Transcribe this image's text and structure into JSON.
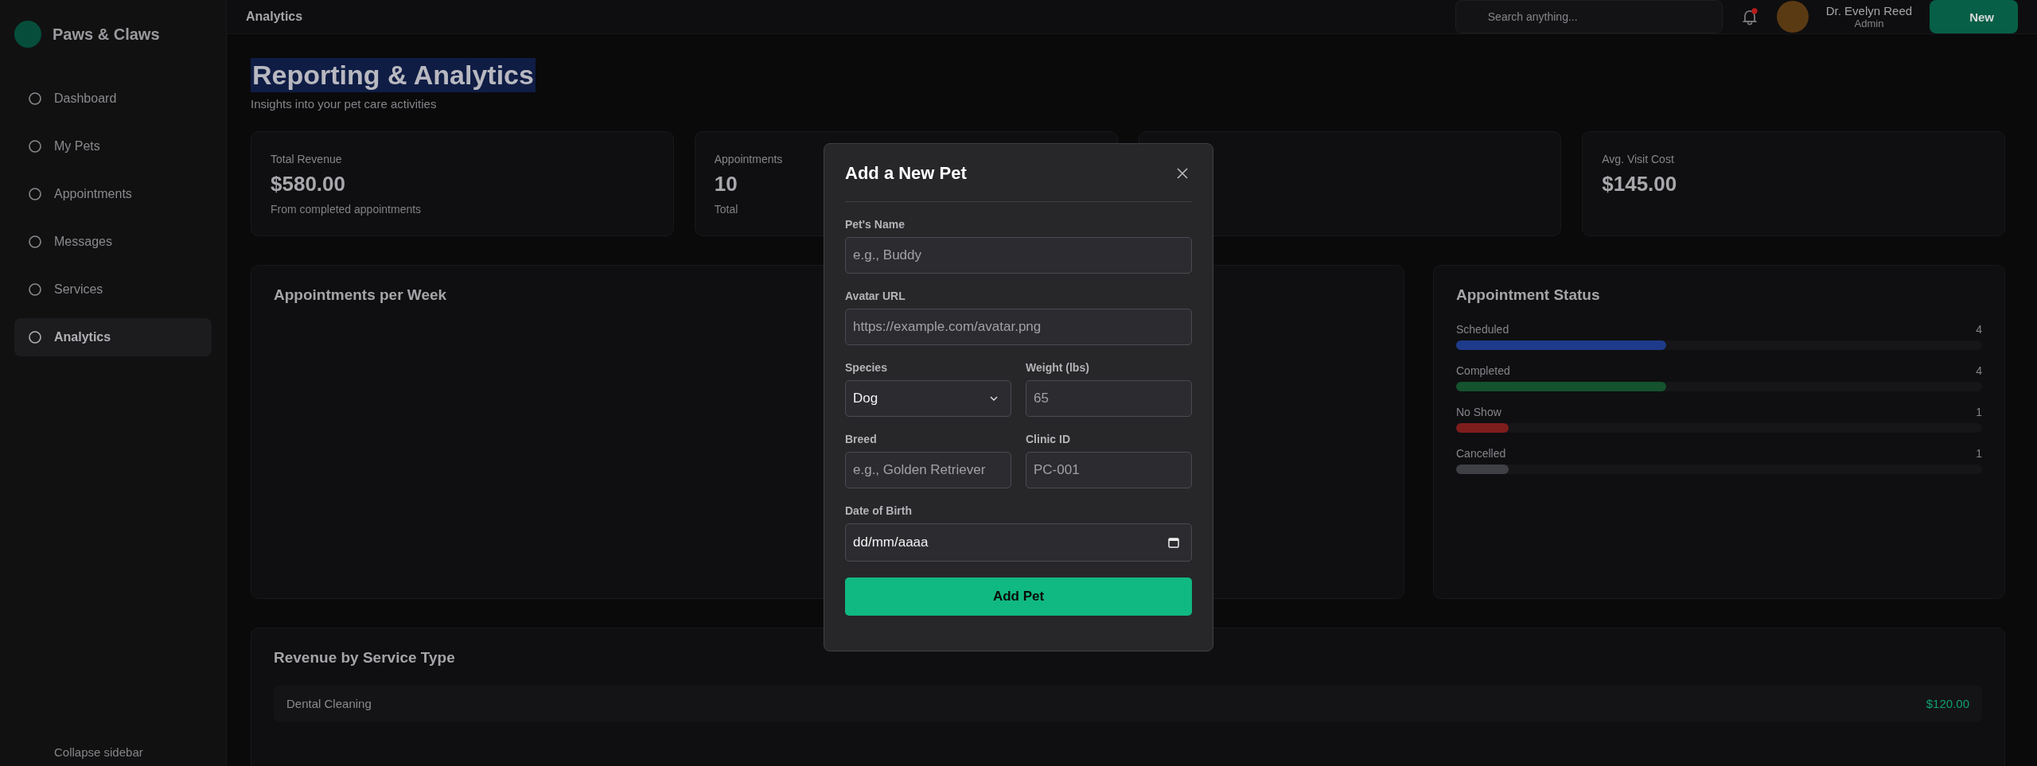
{
  "sidebar": {
    "brand": "Paws & Claws",
    "items": [
      {
        "label": "Dashboard",
        "selected": false
      },
      {
        "label": "My Pets",
        "selected": false
      },
      {
        "label": "Appointments",
        "selected": false
      },
      {
        "label": "Messages",
        "selected": false
      },
      {
        "label": "Services",
        "selected": false
      },
      {
        "label": "Analytics",
        "selected": true
      }
    ],
    "footer": "Collapse sidebar"
  },
  "header": {
    "title": "Analytics",
    "search": {
      "placeholder": "Search anything..."
    },
    "user": {
      "name": "Dr. Evelyn Reed",
      "role": "Admin"
    },
    "new_button": "New"
  },
  "page": {
    "title": "Reporting & Analytics",
    "subtitle": "Insights into your pet care activities"
  },
  "stats": [
    {
      "label": "Total Revenue",
      "value": "$580.00",
      "note": "From completed appointments"
    },
    {
      "label": "Appointments",
      "value": "10",
      "note": "Total"
    },
    {
      "label": "Avg. Visit Cost",
      "value": "$145.00"
    }
  ],
  "weekly_panel": {
    "title": "Appointments per Week"
  },
  "status_panel": {
    "title": "Appointment Status",
    "items": [
      {
        "label": "Scheduled",
        "count": "4",
        "level": 0.4,
        "color": "#1e3a8a"
      },
      {
        "label": "Completed",
        "count": "4",
        "level": 0.4,
        "color": "#14532d"
      },
      {
        "label": "No Show",
        "count": "1",
        "level": 0.1,
        "color": "#7f1d1d"
      },
      {
        "label": "Cancelled",
        "count": "1",
        "level": 0.1,
        "color": "#3f3f46"
      }
    ]
  },
  "revenue_panel": {
    "title": "Revenue by Service Type",
    "rows": [
      {
        "service": "Dental Cleaning",
        "amount": "$120.00"
      }
    ]
  },
  "modal": {
    "title": "Add a New Pet",
    "rows": [
      [
        {
          "label": "Pet's Name",
          "kind": "text",
          "placeholder": "e.g., Buddy"
        }
      ],
      [
        {
          "label": "Avatar URL",
          "kind": "text",
          "placeholder": "https://example.com/avatar.png"
        }
      ],
      [
        {
          "label": "Species",
          "kind": "select",
          "value": "Dog"
        },
        {
          "label": "Weight (lbs)",
          "kind": "text",
          "placeholder": "65"
        }
      ],
      [
        {
          "label": "Breed",
          "kind": "text",
          "placeholder": "e.g., Golden Retriever"
        },
        {
          "label": "Clinic ID",
          "kind": "text",
          "placeholder": "PC-001"
        }
      ],
      [
        {
          "label": "Date of Birth",
          "kind": "date",
          "value": "dd/mm/aaaa"
        }
      ]
    ],
    "submit": "Add Pet"
  }
}
